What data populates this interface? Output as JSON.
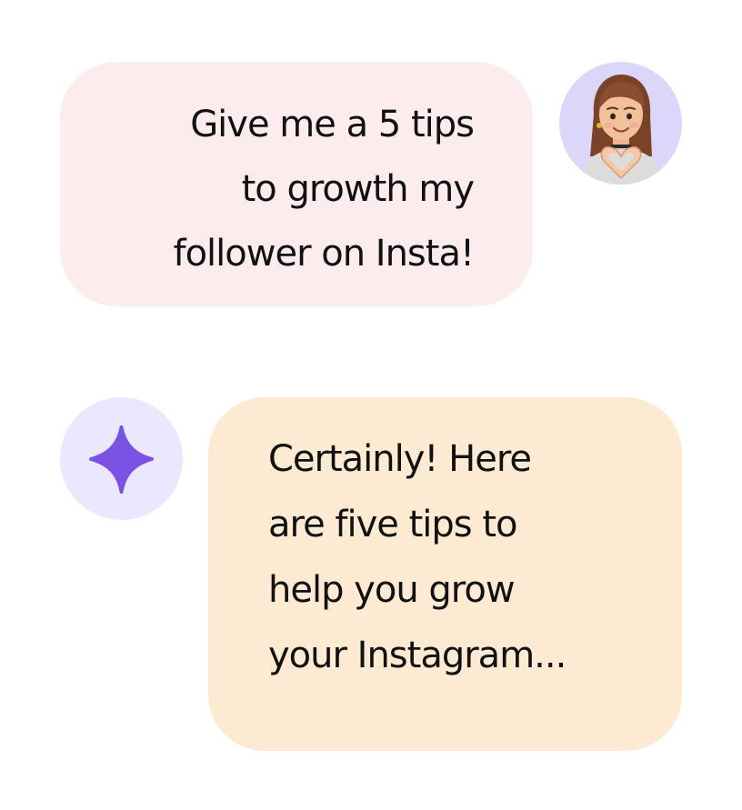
{
  "chat": {
    "user_message": {
      "lines": [
        "Give me a 5 tips",
        "to growth my",
        "follower on Insta!"
      ],
      "bubble_color": "#fdeced"
    },
    "user_avatar": {
      "icon": "memoji-girl-heart-hands-icon",
      "background_color": "#ddd6fb"
    },
    "ai_message": {
      "lines": [
        "Certainly! Here",
        "are five tips to",
        "help you grow",
        "your Instagram..."
      ],
      "bubble_color": "#fcead2"
    },
    "ai_avatar": {
      "icon": "four-point-sparkle-icon",
      "background_color": "#ebe7fe",
      "accent_color": "#7a52e4"
    }
  }
}
